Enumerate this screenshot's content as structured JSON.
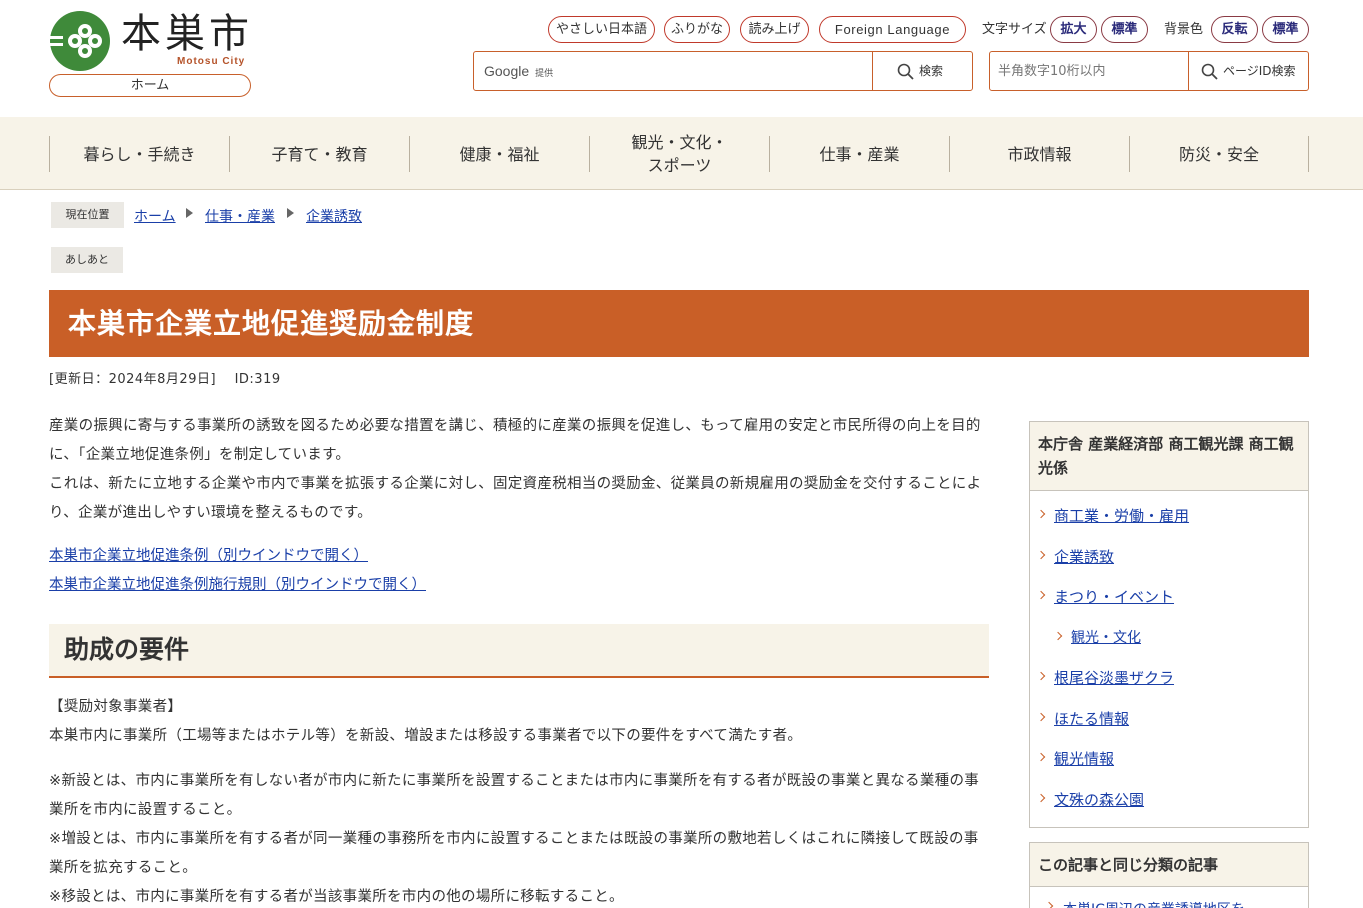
{
  "header": {
    "site_name": "本巣市",
    "site_name_en": "Motosu City",
    "home_label": "ホーム",
    "utility_links": [
      "やさしい日本語",
      "ふりがな",
      "読み上げ",
      "Foreign Language"
    ],
    "font_size": {
      "label": "文字サイズ",
      "larger": "拡大",
      "standard": "標準"
    },
    "bg_color": {
      "label": "背景色",
      "invert": "反転",
      "standard": "標準"
    },
    "search": {
      "provider": "Google",
      "provider_note": "提供",
      "button": "検索"
    },
    "page_id_search": {
      "placeholder": "半角数字10桁以内",
      "button": "ページID検索"
    }
  },
  "global_nav": [
    "暮らし・手続き",
    "子育て・教育",
    "健康・福祉",
    "観光・文化・\nスポーツ",
    "仕事・産業",
    "市政情報",
    "防災・安全"
  ],
  "breadcrumb": {
    "label": "現在位置",
    "items": [
      "ホーム",
      "仕事・産業",
      "企業誘致"
    ]
  },
  "ashiato_label": "あしあと",
  "page": {
    "title": "本巣市企業立地促進奨励金制度",
    "updated": "[更新日：2024年8月29日]",
    "id": "ID:319",
    "intro": [
      "産業の振興に寄与する事業所の誘致を図るため必要な措置を講じ、積極的に産業の振興を促進し、もって雇用の安定と市民所得の向上を目的に、「企業立地促進条例」を制定しています。",
      "これは、新たに立地する企業や市内で事業を拡張する企業に対し、固定資産税相当の奨励金、従業員の新規雇用の奨励金を交付することにより、企業が進出しやすい環境を整えるものです。"
    ],
    "links": [
      "本巣市企業立地促進条例（別ウインドウで開く）",
      "本巣市企業立地促進条例施行規則（別ウインドウで開く）"
    ],
    "section_heading": "助成の要件",
    "requirement_label": "【奨励対象事業者】",
    "requirement_text": "本巣市内に事業所（工場等またはホテル等）を新設、増設または移設する事業者で以下の要件をすべて満たす者。",
    "notes": [
      "※新設とは、市内に事業所を有しない者が市内に新たに事業所を設置することまたは市内に事業所を有する者が既設の事業と異なる業種の事業所を市内に設置すること。",
      "※増設とは、市内に事業所を有する者が同一業種の事務所を市内に設置することまたは既設の事業所の敷地若しくはこれに隣接して既設の事業所を拡充すること。",
      "※移設とは、市内に事業所を有する者が当該事業所を市内の他の場所に移転すること。"
    ]
  },
  "sidebar": {
    "dept_title": "本庁舎 産業経済部 商工観光課 商工観光係",
    "items": [
      {
        "label": "商工業・労働・雇用",
        "sub": false
      },
      {
        "label": "企業誘致",
        "sub": false
      },
      {
        "label": "まつり・イベント",
        "sub": false
      },
      {
        "label": "観光・文化",
        "sub": true
      },
      {
        "label": "根尾谷淡墨ザクラ",
        "sub": false
      },
      {
        "label": "ほたる情報",
        "sub": false
      },
      {
        "label": "観光情報",
        "sub": false
      },
      {
        "label": "文殊の森公園",
        "sub": false
      }
    ],
    "related_title": "この記事と同じ分類の記事",
    "related_first": "本巣IC周辺の産業誘導地区を"
  },
  "colors": {
    "accent": "#c95f27",
    "link": "#1a3fa8",
    "nav_bg": "#f7f3e8",
    "logo_green": "#3f8a3a"
  }
}
